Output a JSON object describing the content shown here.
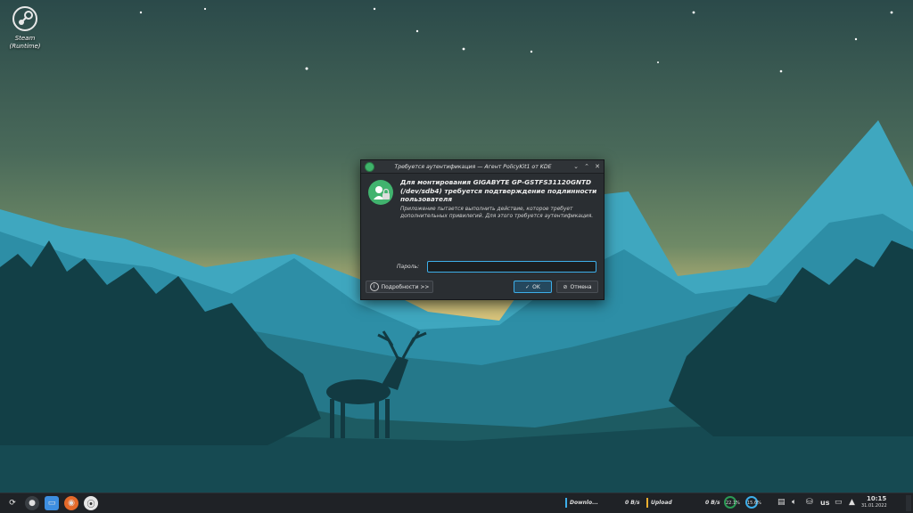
{
  "desktop": {
    "steam_label_line1": "Steam",
    "steam_label_line2": "(Runtime)"
  },
  "dialog": {
    "title": "Требуется аутентификация — Агент PolicyKit1 от KDE",
    "heading": "Для монтирования GIGABYTE GP-GSTFS31120GNTD (/dev/sdb4) требуется подтверждение подлинности пользователя",
    "description": "Приложение пытается выполнить действие, которое требует дополнительных привилегий. Для этого требуется аутентификация.",
    "password_label": "Пароль:",
    "password_value": "",
    "details_button": "Подробности >>",
    "ok_button": "OK",
    "cancel_button": "Отмена"
  },
  "taskbar": {
    "download_label": "Downlo...",
    "download_rate": "0 B/s",
    "upload_label": "Upload",
    "upload_rate": "0 B/s",
    "cpu_percent": "22.1%",
    "mem_percent": "15.6%",
    "keyboard_layout": "us",
    "time": "10:15",
    "date": "31.01.2022"
  },
  "colors": {
    "accent": "#3daee9",
    "policykit_green": "#41b36e",
    "dialog_bg": "#2a2e32",
    "taskbar_bg": "#1f2226"
  }
}
